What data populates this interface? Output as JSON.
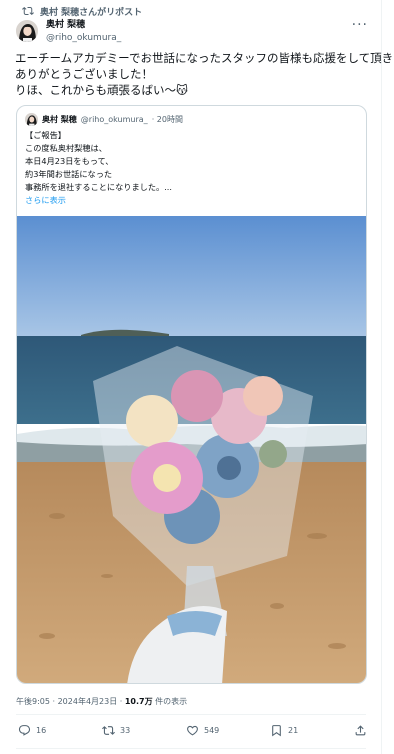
{
  "repost": {
    "text": "奥村 梨穂さんがリポスト"
  },
  "author": {
    "name": "奥村 梨穂",
    "handle": "@riho_okumura_"
  },
  "menu": {
    "more_label": "···"
  },
  "tweet": {
    "lines": [
      "エーチームアカデミーでお世話になったスタッフの皆様も応援をして頂き",
      "ありがとうございました！",
      "りほ、これからも頑張るばい〜😽"
    ]
  },
  "quote": {
    "name": "奥村 梨穂",
    "handle": "@riho_okumura_",
    "time": "· 20時間",
    "lines": [
      "【ご報告】",
      "この度私奥村梨穂は、",
      "本日4月23日をもって、",
      "約3年間お世話になった",
      "事務所を退社することになりました。..."
    ],
    "show_more": "さらに表示"
  },
  "meta": {
    "datetime": "午後9:05 · 2024年4月23日 · ",
    "views": "10.7万",
    "views_suffix": " 件の表示"
  },
  "actions": {
    "replies": "16",
    "reposts": "33",
    "likes": "549",
    "bookmarks": "21"
  },
  "colors": {
    "accent": "#1d9bf0",
    "text": "#0f1419",
    "muted": "#536471",
    "border": "#cfd9de"
  }
}
